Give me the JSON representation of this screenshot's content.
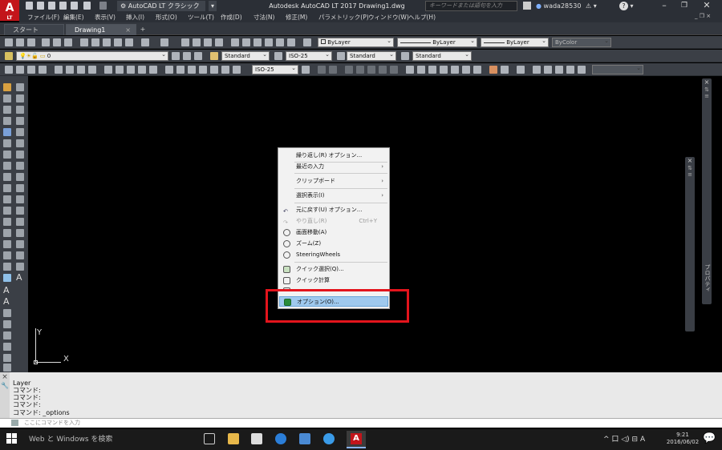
{
  "app": {
    "logo": "A",
    "logo_sub": "LT",
    "window_title": "Autodesk AutoCAD LT 2017   Drawing1.dwg",
    "workspace": "AutoCAD LT クラシック",
    "search_placeholder": "キーワードまたは語句を入力",
    "user": "wada28530",
    "help_icon": "?"
  },
  "window_controls": {
    "minimize": "–",
    "maximize": "❐",
    "close": "✕"
  },
  "menubar": [
    "ファイル(F)",
    "編集(E)",
    "表示(V)",
    "挿入(I)",
    "形式(O)",
    "ツール(T)",
    "作成(D)",
    "寸法(N)",
    "修正(M)",
    "パラメトリック(P)",
    "ウィンドウ(W)",
    "ヘルプ(H)"
  ],
  "tabs": {
    "start": "スタート",
    "drawing": "Drawing1",
    "close_glyph": "×",
    "add": "+"
  },
  "toolbars": {
    "layer_color": "ByLayer",
    "linetype": "ByLayer",
    "lineweight": "ByLayer",
    "plot_style": "ByColor",
    "current_layer": "0",
    "text_style": "Standard",
    "dim_style": "ISO-25",
    "table_style": "Standard",
    "mleader_style": "Standard",
    "dim_style2": "ISO-25"
  },
  "ucs": {
    "x_label": "X",
    "y_label": "Y"
  },
  "context_menu": {
    "items": [
      {
        "label": "繰り返し(R) オプション...",
        "arrow": "",
        "shortcut": "",
        "disabled": false,
        "icon": ""
      },
      {
        "label": "最近の入力",
        "arrow": "›",
        "shortcut": "",
        "disabled": false,
        "icon": ""
      },
      {
        "label": "クリップボード",
        "arrow": "›",
        "shortcut": "",
        "disabled": false,
        "icon": ""
      },
      {
        "label": "選択表示(I)",
        "arrow": "›",
        "shortcut": "",
        "disabled": false,
        "icon": ""
      },
      {
        "label": "元に戻す(U) オプション...",
        "arrow": "",
        "shortcut": "",
        "disabled": false,
        "icon": "undo-icon"
      },
      {
        "label": "やり直し(R)",
        "arrow": "",
        "shortcut": "Ctrl+Y",
        "disabled": true,
        "icon": "redo-icon"
      },
      {
        "label": "画面移動(A)",
        "arrow": "",
        "shortcut": "",
        "disabled": false,
        "icon": "pan-icon"
      },
      {
        "label": "ズーム(Z)",
        "arrow": "",
        "shortcut": "",
        "disabled": false,
        "icon": "zoom-icon"
      },
      {
        "label": "SteeringWheels",
        "arrow": "",
        "shortcut": "",
        "disabled": false,
        "icon": "steering-wheel-icon"
      },
      {
        "label": "クイック選択(Q)...",
        "arrow": "",
        "shortcut": "",
        "disabled": false,
        "icon": "quick-select-icon"
      },
      {
        "label": "クイック計算",
        "arrow": "",
        "shortcut": "",
        "disabled": false,
        "icon": "calculator-icon"
      },
      {
        "label": "オプション(O)...",
        "arrow": "",
        "shortcut": "",
        "disabled": false,
        "icon": "options-icon"
      }
    ]
  },
  "palettes": {
    "properties_label": "プロパティ"
  },
  "command_window": {
    "history": [
      "Layer",
      "コマンド:",
      "コマンド:",
      "コマンド:",
      "コマンド: _options"
    ],
    "input_placeholder": "ここにコマンドを入力"
  },
  "taskbar": {
    "search_text": "Web と Windows を検索",
    "tray_text": "^ 口 ◁) ⊟ A",
    "time": "9:21",
    "date": "2016/06/02"
  },
  "colors": {
    "highlight_frame": "#e3141c",
    "menu_selection": "#9fc9ee",
    "autocad_red": "#c3151b"
  }
}
